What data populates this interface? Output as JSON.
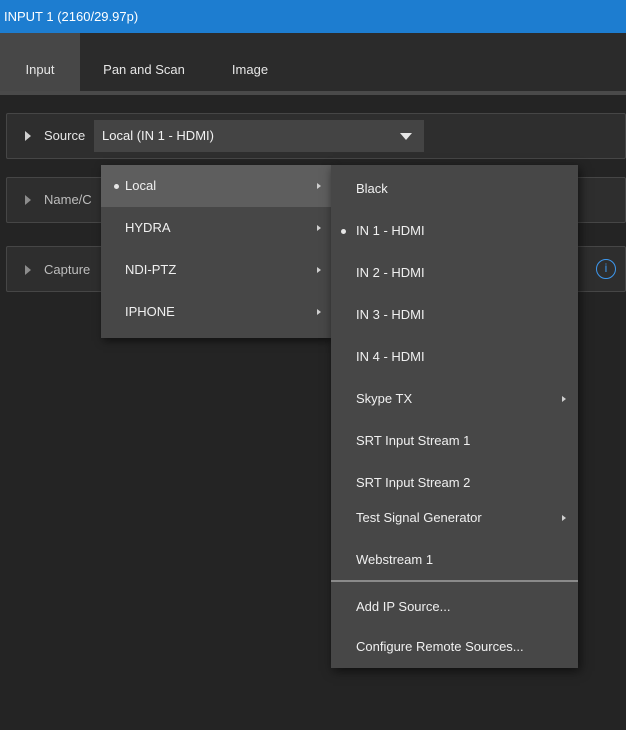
{
  "window": {
    "title": "INPUT 1  (2160/29.97p)"
  },
  "tabs": [
    {
      "label": "Input",
      "active": true
    },
    {
      "label": "Pan and Scan",
      "active": false
    },
    {
      "label": "Image",
      "active": false
    }
  ],
  "source": {
    "label": "Source",
    "value": "Local (IN 1 - HDMI)"
  },
  "rows": {
    "name_label": "Name/C",
    "capture_label": "Capture"
  },
  "icons": {
    "info": "info-icon",
    "info_glyph": "i"
  },
  "menu_groups": [
    {
      "label": "Local",
      "selected": true,
      "has_submenu": true
    },
    {
      "label": "HYDRA",
      "selected": false,
      "has_submenu": true
    },
    {
      "label": "NDI-PTZ",
      "selected": false,
      "has_submenu": true
    },
    {
      "label": "IPHONE",
      "selected": false,
      "has_submenu": true
    }
  ],
  "menu_sources": [
    {
      "label": "Black",
      "selected": false,
      "has_submenu": false
    },
    {
      "label": "IN 1 - HDMI",
      "selected": true,
      "has_submenu": false
    },
    {
      "label": "IN 2 - HDMI",
      "selected": false,
      "has_submenu": false
    },
    {
      "label": "IN 3 - HDMI",
      "selected": false,
      "has_submenu": false
    },
    {
      "label": "IN 4 - HDMI",
      "selected": false,
      "has_submenu": false
    },
    {
      "label": "Skype TX",
      "selected": false,
      "has_submenu": true
    },
    {
      "label": "SRT Input Stream 1",
      "selected": false,
      "has_submenu": false
    },
    {
      "label": "SRT Input Stream 2",
      "selected": false,
      "has_submenu": false
    },
    {
      "label": "Test Signal Generator",
      "selected": false,
      "has_submenu": true
    },
    {
      "label": "Webstream 1",
      "selected": false,
      "has_submenu": false
    }
  ],
  "menu_actions": [
    {
      "label": "Add IP Source..."
    },
    {
      "label": "Configure Remote Sources..."
    }
  ],
  "colors": {
    "title_bar": "#1d7dd0",
    "background": "#242424",
    "menu": "#474747",
    "menu_highlight": "#5e5e5e",
    "info_accent": "#3d98ef"
  }
}
